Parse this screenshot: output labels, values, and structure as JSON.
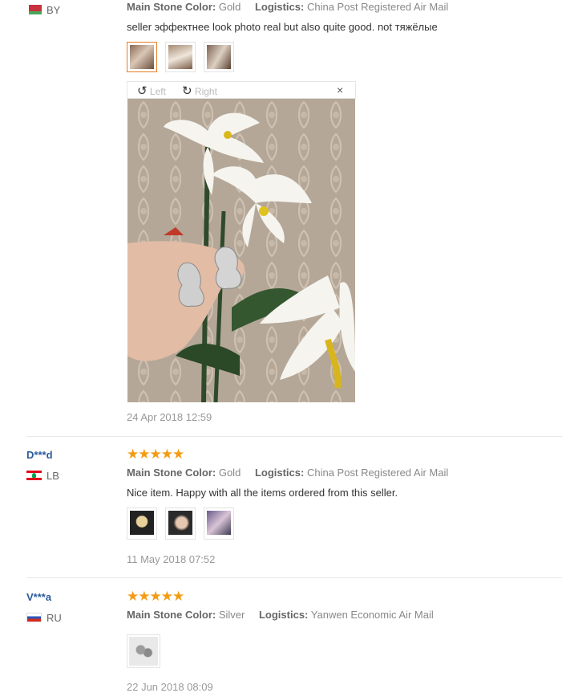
{
  "reviews": [
    {
      "country": "BY",
      "meta": {
        "stone_key": "Main Stone Color:",
        "stone_val": "Gold",
        "log_key": "Logistics:",
        "log_val": "China Post Registered Air Mail"
      },
      "text": "seller эффектнее look photo real but also quite good. not тяжёлые",
      "date": "24 Apr 2018 12:59"
    },
    {
      "user": "D***d",
      "country": "LB",
      "meta": {
        "stone_key": "Main Stone Color:",
        "stone_val": "Gold",
        "log_key": "Logistics:",
        "log_val": "China Post Registered Air Mail"
      },
      "text": "Nice item. Happy with all the items ordered from this seller.",
      "date": "11 May 2018 07:52"
    },
    {
      "user": "V***a",
      "country": "RU",
      "meta": {
        "stone_key": "Main Stone Color:",
        "stone_val": "Silver",
        "log_key": "Logistics:",
        "log_val": "Yanwen Economic Air Mail"
      },
      "date": "22 Jun 2018 08:09"
    }
  ],
  "viewer": {
    "rotate_left": "Left",
    "rotate_right": "Right",
    "close": "×"
  },
  "stars": "★★★★★",
  "colors": {
    "accent": "#e67e22",
    "star": "#f39c12",
    "user": "#2a5a9c"
  }
}
